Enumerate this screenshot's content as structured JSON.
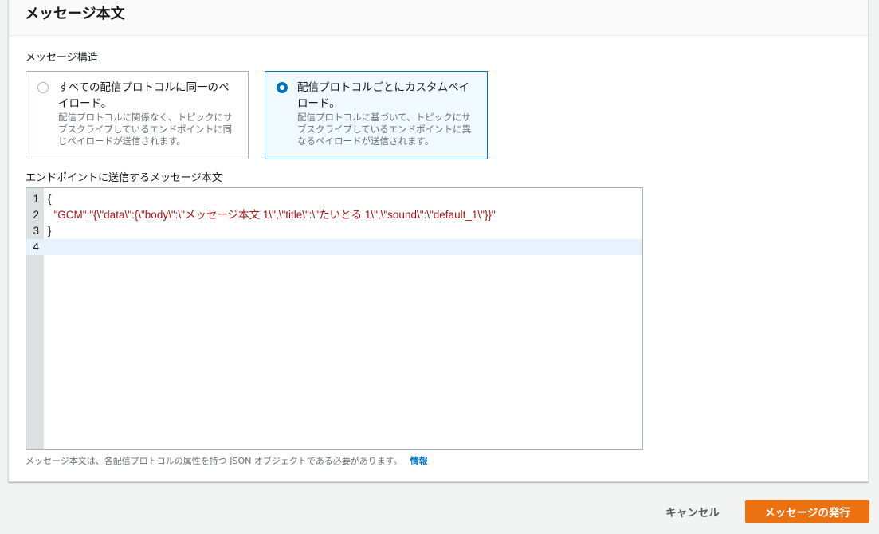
{
  "panel": {
    "title": "メッセージ本文"
  },
  "structure": {
    "label": "メッセージ構造",
    "options": [
      {
        "title": "すべての配信プロトコルに同一のペイロード。",
        "description": "配信プロトコルに関係なく、トピックにサブスクライブしているエンドポイントに同じペイロードが送信されます。",
        "selected": false
      },
      {
        "title": "配信プロトコルごとにカスタムペイロード。",
        "description": "配信プロトコルに基づいて、トピックにサブスクライブしているエンドポイントに異なるペイロードが送信されます。",
        "selected": true
      }
    ]
  },
  "editor": {
    "label": "エンドポイントに送信するメッセージ本文",
    "lines": [
      {
        "n": "1",
        "text": "{"
      },
      {
        "n": "2",
        "text": "  \"GCM\":\"{\\\"data\\\":{\\\"body\\\":\\\"メッセージ本文 1\\\",\\\"title\\\":\\\"たいとる 1\\\",\\\"sound\\\":\\\"default_1\\\"}}\""
      },
      {
        "n": "3",
        "text": "}"
      },
      {
        "n": "4",
        "text": ""
      }
    ],
    "hint": "メッセージ本文は、各配信プロトコルの属性を持つ JSON オブジェクトである必要があります。",
    "info_link": "情報"
  },
  "actions": {
    "cancel": "キャンセル",
    "publish": "メッセージの発行"
  },
  "colors": {
    "accent": "#0073bb",
    "primary": "#ec7211"
  }
}
